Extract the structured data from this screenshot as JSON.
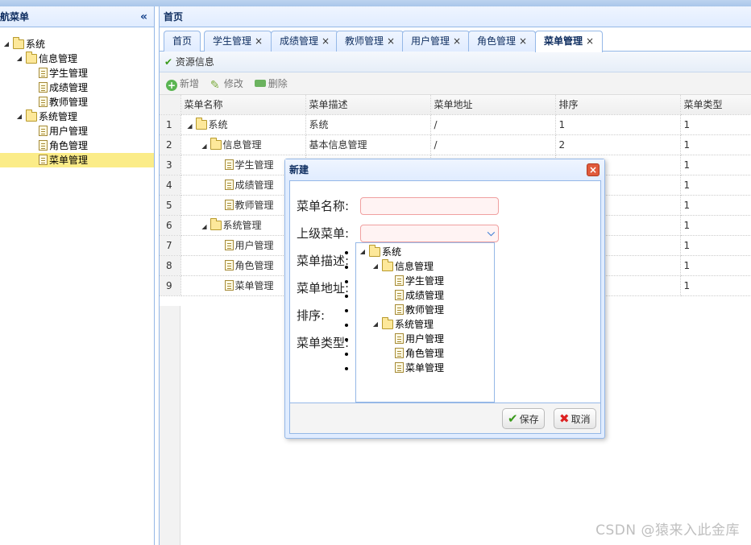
{
  "west": {
    "title": "导航菜单",
    "collapse_glyph": "«",
    "tree": [
      {
        "label": "系统",
        "level": 0,
        "type": "folder",
        "expanded": true
      },
      {
        "label": "信息管理",
        "level": 1,
        "type": "folder",
        "expanded": true
      },
      {
        "label": "学生管理",
        "level": 2,
        "type": "file"
      },
      {
        "label": "成绩管理",
        "level": 2,
        "type": "file"
      },
      {
        "label": "教师管理",
        "level": 2,
        "type": "file"
      },
      {
        "label": "系统管理",
        "level": 1,
        "type": "folder",
        "expanded": true
      },
      {
        "label": "用户管理",
        "level": 2,
        "type": "file"
      },
      {
        "label": "角色管理",
        "level": 2,
        "type": "file"
      },
      {
        "label": "菜单管理",
        "level": 2,
        "type": "file",
        "selected": true
      }
    ]
  },
  "center": {
    "title": "首页",
    "tabs": [
      {
        "label": "首页",
        "closable": false
      },
      {
        "label": "学生管理",
        "closable": true
      },
      {
        "label": "成绩管理",
        "closable": true
      },
      {
        "label": "教师管理",
        "closable": true
      },
      {
        "label": "用户管理",
        "closable": true
      },
      {
        "label": "角色管理",
        "closable": true
      },
      {
        "label": "菜单管理",
        "closable": true,
        "active": true
      }
    ],
    "close_glyph": "×",
    "panel_title": "资源信息",
    "toolbar": {
      "add": "新增",
      "edit": "修改",
      "delete": "删除"
    },
    "grid": {
      "columns": [
        "菜单名称",
        "菜单描述",
        "菜单地址",
        "排序",
        "菜单类型"
      ],
      "rows": [
        {
          "n": "1",
          "name": "系统",
          "level": 0,
          "type": "folder",
          "desc": "系统",
          "url": "/",
          "sort": "1",
          "mtype": "1"
        },
        {
          "n": "2",
          "name": "信息管理",
          "level": 1,
          "type": "folder",
          "desc": "基本信息管理",
          "url": "/",
          "sort": "2",
          "mtype": "1"
        },
        {
          "n": "3",
          "name": "学生管理",
          "level": 2,
          "type": "file",
          "desc": "",
          "url": "",
          "sort": "",
          "mtype": "1"
        },
        {
          "n": "4",
          "name": "成绩管理",
          "level": 2,
          "type": "file",
          "desc": "",
          "url": "",
          "sort": "",
          "mtype": "1"
        },
        {
          "n": "5",
          "name": "教师管理",
          "level": 2,
          "type": "file",
          "desc": "",
          "url": "",
          "sort": "",
          "mtype": "1"
        },
        {
          "n": "6",
          "name": "系统管理",
          "level": 1,
          "type": "folder",
          "desc": "",
          "url": "",
          "sort": "",
          "mtype": "1"
        },
        {
          "n": "7",
          "name": "用户管理",
          "level": 2,
          "type": "file",
          "desc": "",
          "url": "",
          "sort": "",
          "mtype": "1"
        },
        {
          "n": "8",
          "name": "角色管理",
          "level": 2,
          "type": "file",
          "desc": "",
          "url": "",
          "sort": "",
          "mtype": "1"
        },
        {
          "n": "9",
          "name": "菜单管理",
          "level": 2,
          "type": "file",
          "desc": "",
          "url": "",
          "sort": "",
          "mtype": "1"
        }
      ]
    }
  },
  "dialog": {
    "title": "新建",
    "fields": {
      "name_label": "菜单名称:",
      "parent_label": "上级菜单:",
      "desc_label": "菜单描述:",
      "url_label": "菜单地址:",
      "sort_label": "排序:",
      "type_label": "菜单类型:"
    },
    "name_value": "",
    "parent_value": "",
    "dropdown_tree": [
      {
        "label": "系统",
        "level": 0,
        "type": "folder"
      },
      {
        "label": "信息管理",
        "level": 1,
        "type": "folder"
      },
      {
        "label": "学生管理",
        "level": 2,
        "type": "file"
      },
      {
        "label": "成绩管理",
        "level": 2,
        "type": "file"
      },
      {
        "label": "教师管理",
        "level": 2,
        "type": "file"
      },
      {
        "label": "系统管理",
        "level": 1,
        "type": "folder"
      },
      {
        "label": "用户管理",
        "level": 2,
        "type": "file"
      },
      {
        "label": "角色管理",
        "level": 2,
        "type": "file"
      },
      {
        "label": "菜单管理",
        "level": 2,
        "type": "file"
      }
    ],
    "save_label": "保存",
    "cancel_label": "取消"
  },
  "watermark": "CSDN @猿来入此金库"
}
